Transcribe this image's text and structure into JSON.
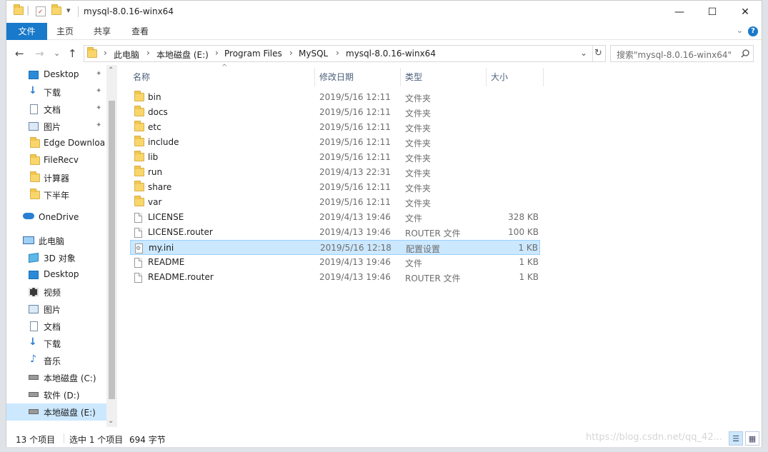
{
  "window": {
    "title": "mysql-8.0.16-winx64",
    "quick_access_sep": "|",
    "dropdown_glyph": "▾",
    "controls": {
      "minimize": "—",
      "maximize": "☐",
      "close": "✕"
    }
  },
  "ribbon": {
    "tabs": [
      "文件",
      "主页",
      "共享",
      "查看"
    ],
    "active_tab": "文件",
    "collapse_glyph": "⌄",
    "help_glyph": "?"
  },
  "nav": {
    "back": "←",
    "forward": "→",
    "history": "⌄",
    "up": "↑",
    "refresh": "↻",
    "address_dropdown": "⌄",
    "crumb_sep": "›"
  },
  "address": {
    "crumbs": [
      "此电脑",
      "本地磁盘 (E:)",
      "Program Files",
      "MySQL",
      "mysql-8.0.16-winx64"
    ]
  },
  "search": {
    "placeholder": "搜索\"mysql-8.0.16-winx64\"",
    "icon": "search-icon"
  },
  "sidebar": {
    "items": [
      {
        "label": "Desktop",
        "icon": "desktop-icon",
        "pinned": true
      },
      {
        "label": "下载",
        "icon": "download-icon",
        "pinned": true
      },
      {
        "label": "文档",
        "icon": "document-icon",
        "pinned": true
      },
      {
        "label": "图片",
        "icon": "picture-icon",
        "pinned": true
      },
      {
        "label": "Edge Downloa",
        "icon": "folder-icon",
        "pinned": false
      },
      {
        "label": "FileRecv",
        "icon": "folder-icon",
        "pinned": false
      },
      {
        "label": "计算器",
        "icon": "folder-icon",
        "pinned": false
      },
      {
        "label": "下半年",
        "icon": "folder-icon",
        "pinned": false
      },
      {
        "label": "OneDrive",
        "icon": "cloud-icon",
        "pinned": false
      },
      {
        "label": "此电脑",
        "icon": "computer-icon",
        "pinned": false
      },
      {
        "label": "3D 对象",
        "icon": "cube-icon",
        "pinned": false
      },
      {
        "label": "Desktop",
        "icon": "desktop-icon",
        "pinned": false
      },
      {
        "label": "视频",
        "icon": "video-icon",
        "pinned": false
      },
      {
        "label": "图片",
        "icon": "picture-icon",
        "pinned": false
      },
      {
        "label": "文档",
        "icon": "document-icon",
        "pinned": false
      },
      {
        "label": "下载",
        "icon": "download-icon",
        "pinned": false
      },
      {
        "label": "音乐",
        "icon": "music-icon",
        "pinned": false
      },
      {
        "label": "本地磁盘 (C:)",
        "icon": "drive-icon",
        "pinned": false
      },
      {
        "label": "软件 (D:)",
        "icon": "drive-icon",
        "pinned": false
      },
      {
        "label": "本地磁盘 (E:)",
        "icon": "drive-icon",
        "pinned": false,
        "selected": true
      }
    ],
    "pin_glyph": "📌",
    "scroll_up": "⌃",
    "scroll_down": "⌄"
  },
  "files": {
    "columns": {
      "name": "名称",
      "date": "修改日期",
      "type": "类型",
      "size": "大小"
    },
    "sort_indicator": "^",
    "rows": [
      {
        "name": "bin",
        "date": "2019/5/16 12:11",
        "type": "文件夹",
        "size": "",
        "kind": "folder"
      },
      {
        "name": "docs",
        "date": "2019/5/16 12:11",
        "type": "文件夹",
        "size": "",
        "kind": "folder"
      },
      {
        "name": "etc",
        "date": "2019/5/16 12:11",
        "type": "文件夹",
        "size": "",
        "kind": "folder"
      },
      {
        "name": "include",
        "date": "2019/5/16 12:11",
        "type": "文件夹",
        "size": "",
        "kind": "folder"
      },
      {
        "name": "lib",
        "date": "2019/5/16 12:11",
        "type": "文件夹",
        "size": "",
        "kind": "folder"
      },
      {
        "name": "run",
        "date": "2019/4/13 22:31",
        "type": "文件夹",
        "size": "",
        "kind": "folder"
      },
      {
        "name": "share",
        "date": "2019/5/16 12:11",
        "type": "文件夹",
        "size": "",
        "kind": "folder"
      },
      {
        "name": "var",
        "date": "2019/5/16 12:11",
        "type": "文件夹",
        "size": "",
        "kind": "folder"
      },
      {
        "name": "LICENSE",
        "date": "2019/4/13 19:46",
        "type": "文件",
        "size": "328 KB",
        "kind": "file"
      },
      {
        "name": "LICENSE.router",
        "date": "2019/4/13 19:46",
        "type": "ROUTER 文件",
        "size": "100 KB",
        "kind": "file"
      },
      {
        "name": "my.ini",
        "date": "2019/5/16 12:18",
        "type": "配置设置",
        "size": "1 KB",
        "kind": "ini",
        "selected": true
      },
      {
        "name": "README",
        "date": "2019/4/13 19:46",
        "type": "文件",
        "size": "1 KB",
        "kind": "file"
      },
      {
        "name": "README.router",
        "date": "2019/4/13 19:46",
        "type": "ROUTER 文件",
        "size": "1 KB",
        "kind": "file"
      }
    ]
  },
  "status": {
    "count": "13 个项目",
    "selection": "选中 1 个项目",
    "size": "694 字节"
  },
  "watermark": "https://blog.csdn.net/qq_42..."
}
